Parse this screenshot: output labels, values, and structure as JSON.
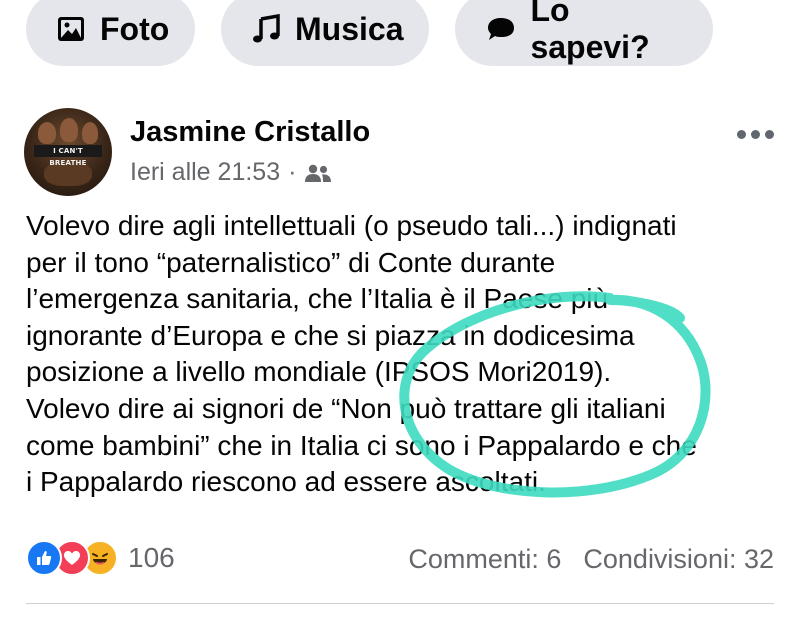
{
  "chips": [
    {
      "label": "Foto",
      "icon": "photo-icon"
    },
    {
      "label": "Musica",
      "icon": "music-note-icon"
    },
    {
      "label": "Lo sapevi?",
      "icon": "speech-bubble-icon"
    }
  ],
  "post": {
    "author": "Jasmine Cristallo",
    "timestamp": "Ieri alle 21:53",
    "separator": "·",
    "audience_icon": "friends-icon",
    "avatar_text": "I CAN'T BREATHE",
    "text_lines": [
      "Volevo dire agli intellettuali (o pseudo tali...) indignati",
      "per il tono “paternalistico” di Conte durante",
      "l’emergenza sanitaria, che l’Italia è il Paese più",
      "ignorante d’Europa e che si piazza in dodicesima",
      "posizione a livello mondiale (IPSOS Mori2019).",
      "Volevo dire ai signori de “Non può trattare gli italiani",
      "come bambini” che in Italia ci sono i Pappalardo e che",
      "i Pappalardo riescono ad essere ascoltati."
    ],
    "highlight_color": "#3ddbc0"
  },
  "footer": {
    "reaction_count": "106",
    "reactions": [
      "like-icon",
      "love-icon",
      "haha-icon"
    ],
    "comments": "Commenti: 6",
    "shares": "Condivisioni: 32"
  },
  "colors": {
    "chip_bg": "#e4e6eb",
    "secondary_text": "#65676b",
    "like": "#1877f2",
    "love": "#f33e58",
    "haha": "#f7b125"
  }
}
